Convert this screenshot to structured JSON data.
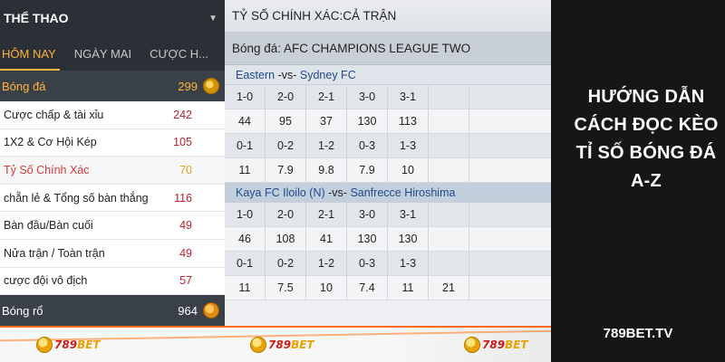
{
  "sidebar": {
    "title": "THỂ THAO",
    "tabs": [
      "HÔM NAY",
      "NGÀY MAI",
      "CƯỢC H..."
    ],
    "sports": [
      {
        "label": "Bóng đá",
        "count": "299",
        "icon": "soccer-ball-icon"
      },
      {
        "label": "Bóng rổ",
        "count": "964",
        "icon": "basketball-icon"
      }
    ],
    "football_items": [
      {
        "label": "Cược chấp & tài xỉu",
        "count": "242"
      },
      {
        "label": "1X2 & Cơ Hội Kép",
        "count": "105"
      },
      {
        "label": "Tỷ Số Chính Xác",
        "count": "70"
      },
      {
        "label": "chẵn lẻ & Tổng số bàn thắng",
        "count": "116"
      },
      {
        "label": "Bàn đầu/Bàn cuối",
        "count": "49"
      },
      {
        "label": "Nửa trận / Toàn trận",
        "count": "49"
      },
      {
        "label": "cược đội vô địch",
        "count": "57"
      }
    ],
    "active_item": "Tỷ Số Chính Xác"
  },
  "main": {
    "title": "TỶ SỐ CHÍNH XÁC:CẢ TRẬN",
    "league": "Bóng đá: AFC CHAMPIONS LEAGUE TWO",
    "matches": [
      {
        "home": "Eastern",
        "vs": "-vs-",
        "away": "Sydney FC",
        "rows": [
          [
            "1-0",
            "2-0",
            "2-1",
            "3-0",
            "3-1",
            ""
          ],
          [
            "44",
            "95",
            "37",
            "130",
            "113",
            ""
          ],
          [
            "0-1",
            "0-2",
            "1-2",
            "0-3",
            "1-3",
            ""
          ],
          [
            "11",
            "7.9",
            "9.8",
            "7.9",
            "10",
            ""
          ]
        ]
      },
      {
        "home": "Kaya FC Iloilo (N)",
        "vs": "-vs-",
        "away": "Sanfrecce Hiroshima",
        "rows": [
          [
            "1-0",
            "2-0",
            "2-1",
            "3-0",
            "3-1",
            ""
          ],
          [
            "46",
            "108",
            "41",
            "130",
            "130",
            ""
          ],
          [
            "0-1",
            "0-2",
            "1-2",
            "0-3",
            "1-3",
            ""
          ],
          [
            "11",
            "7.5",
            "10",
            "7.4",
            "11",
            "21"
          ]
        ]
      }
    ]
  },
  "banner": {
    "lines": [
      "HƯỚNG DẪN",
      "CÁCH ĐỌC KÈO",
      "TỈ SỐ BÓNG ĐÁ",
      "A-Z"
    ],
    "site": "789BET.TV"
  },
  "watermark": {
    "logos": [
      {
        "num": "789",
        "brand": "BET"
      },
      {
        "num": "789",
        "brand": "BET"
      },
      {
        "num": "789",
        "brand": "BET"
      }
    ]
  },
  "colors": {
    "accent": "#ffb43a",
    "sidebar_dark": "#2a3036",
    "count_red": "#b82230",
    "team_blue": "#1e4a8c",
    "banner_bg": "#161616"
  }
}
